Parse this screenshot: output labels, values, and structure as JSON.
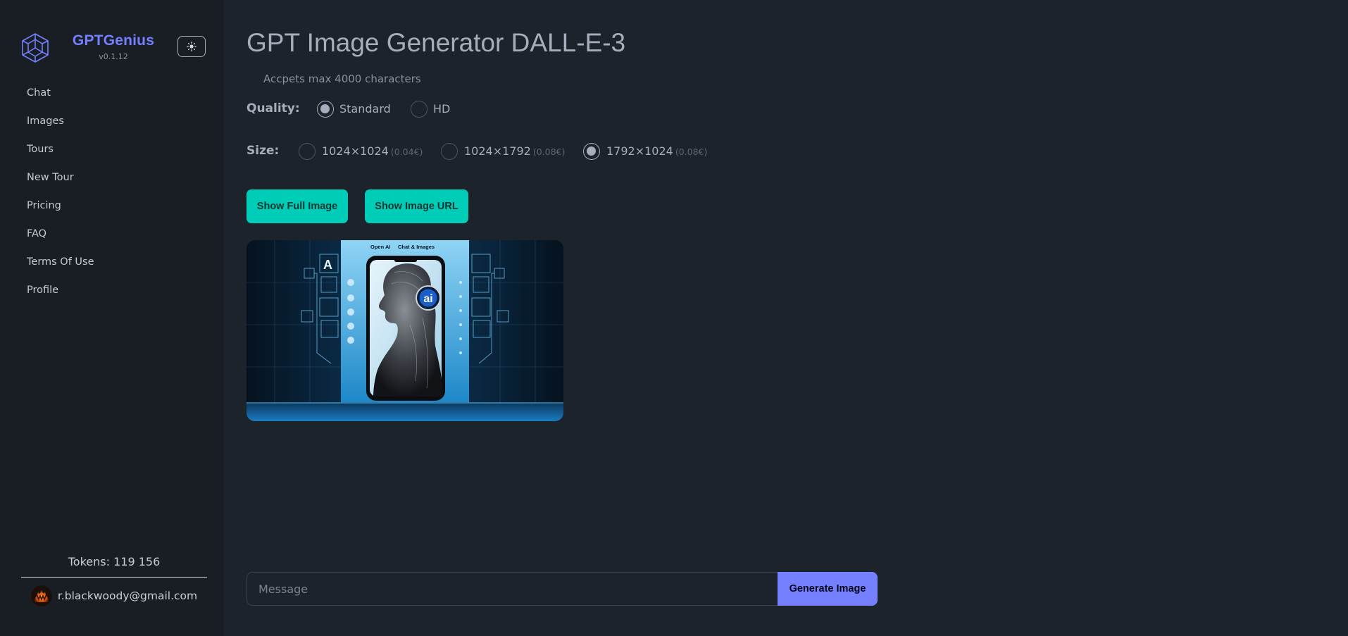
{
  "brand": {
    "name": "GPTGenius",
    "version": "v0.1.12"
  },
  "nav": [
    "Chat",
    "Images",
    "Tours",
    "New Tour",
    "Pricing",
    "FAQ",
    "Terms Of Use",
    "Profile"
  ],
  "tokens": "Tokens: 119 156",
  "user": {
    "email": "r.blackwoody@gmail.com"
  },
  "page": {
    "title": "GPT Image Generator DALL-E-3",
    "hint": "Accpets max 4000 characters"
  },
  "quality": {
    "label": "Quality:",
    "options": [
      {
        "label": "Standard",
        "checked": true
      },
      {
        "label": "HD",
        "checked": false
      }
    ]
  },
  "size": {
    "label": "Size:",
    "options": [
      {
        "label": "1024×1024",
        "price": "(0.04€)",
        "checked": false
      },
      {
        "label": "1024×1792",
        "price": "(0.08€)",
        "checked": false
      },
      {
        "label": "1792×1024",
        "price": "(0.08€)",
        "checked": true
      }
    ]
  },
  "buttons": {
    "show_full": "Show Full Image",
    "show_url": "Show Image URL",
    "generate": "Generate Image"
  },
  "image": {
    "header_left": "Open AI",
    "header_right": "Chat & Images",
    "badge": "ai"
  },
  "message": {
    "placeholder": "Message"
  },
  "colors": {
    "accent": "#7480ff",
    "teal": "#00cdb7",
    "background": "#1d232a",
    "sidebar": "#191e24"
  }
}
